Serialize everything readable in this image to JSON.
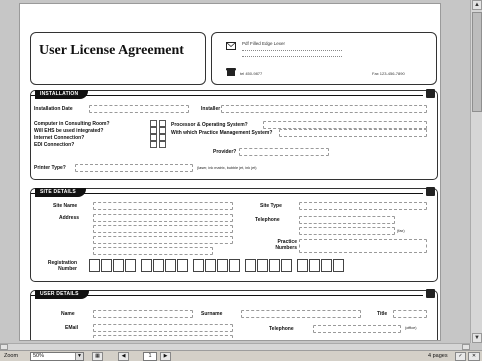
{
  "document": {
    "title": "User License Agreement",
    "header_address": "Pdf Filled Edge Lexer",
    "header_phone": "tel 450-9877",
    "header_fax": "Fax 123-456-7890",
    "installation": {
      "section_label": "INSTALLATION",
      "installation_date_label": "Installation Date",
      "installer_label": "Installer",
      "computer_label": "Computer in Consulting Room?",
      "integrated_label": "Will EHS be used integrated?",
      "internet_label": "Internet Connection?",
      "edi_label": "EDI Connection?",
      "processor_label": "Processor & Operating System?",
      "pms_label": "With which Practice Management System?",
      "provider_label": "Provider?",
      "printer_label": "Printer Type?",
      "printer_note": "(laser, ink matrix, bubble jet, ink jet)"
    },
    "site": {
      "section_label": "SITE DETAILS",
      "site_name_label": "Site Name",
      "site_type_label": "Site Type",
      "address_label": "Address",
      "telephone_label": "Telephone",
      "fax_note": "(fax)",
      "practice_numbers_label": "Practice Numbers",
      "registration_label": "Registration Number"
    },
    "user": {
      "section_label": "USER DETAILS",
      "name_label": "Name",
      "surname_label": "Surname",
      "title_label": "Title",
      "email_label": "EMail",
      "telephone_label": "Telephone",
      "office_note": "(office)"
    }
  },
  "statusbar": {
    "zoom_label": "Zoom",
    "zoom_value": "50%",
    "page_value": "1",
    "pages_text": "4 pages"
  },
  "colors": {
    "section_pill": "#111111",
    "page_bg": "#ffffff",
    "window_bg": "#c6c6c6"
  }
}
